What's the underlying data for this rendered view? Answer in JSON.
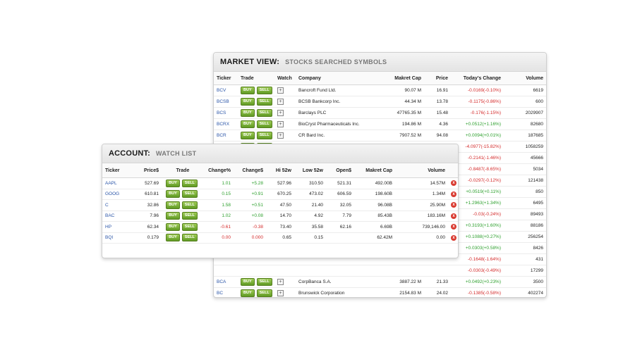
{
  "market": {
    "title": "MARKET VIEW:",
    "subtitle": "STOCKS SEARCHED SYMBOLS",
    "columns": [
      "Ticker",
      "Trade",
      "Watch",
      "Company",
      "Makret Cap",
      "Price",
      "Today's Change",
      "Volume"
    ],
    "rows": [
      {
        "ticker": "BCV",
        "company": "Bancroft Fund Ltd.",
        "cap": "90.07 M",
        "price": "16.91",
        "change": "-0.0169(-0.10%)",
        "dir": "neg",
        "volume": "6619"
      },
      {
        "ticker": "BCSB",
        "company": "BCSB Bankcorp Inc.",
        "cap": "44.34 M",
        "price": "13.78",
        "change": "-0.1175(-0.86%)",
        "dir": "neg",
        "volume": "600"
      },
      {
        "ticker": "BCS",
        "company": "Barclays PLC",
        "cap": "47765.35 M",
        "price": "15.48",
        "change": "-0.176(-1.15%)",
        "dir": "neg",
        "volume": "2029907"
      },
      {
        "ticker": "BCRX",
        "company": "BioCryst Pharmaceuticals Inc.",
        "cap": "194.86 M",
        "price": "4.36",
        "change": "+0.0512(+1.16%)",
        "dir": "pos",
        "volume": "82680"
      },
      {
        "ticker": "BCR",
        "company": "CR Bard Inc.",
        "cap": "7907.52 M",
        "price": "94.08",
        "change": "+0.0094(+0.01%)",
        "dir": "pos",
        "volume": "187685"
      },
      {
        "ticker": "BCPC",
        "company": "Balchem Corp.",
        "cap": "1032.49 M",
        "price": "30",
        "change": "-4.0977(-15.82%)",
        "dir": "neg",
        "volume": "1058259"
      },
      {
        "ticker": "",
        "company": "",
        "cap": "",
        "price": "",
        "change": "-0.2141(-1.46%)",
        "dir": "neg",
        "volume": "45666"
      },
      {
        "ticker": "",
        "company": "",
        "cap": "",
        "price": "",
        "change": "-0.8487(-8.65%)",
        "dir": "neg",
        "volume": "5034"
      },
      {
        "ticker": "",
        "company": "",
        "cap": "",
        "price": "",
        "change": "-0.0297(-0.12%)",
        "dir": "neg",
        "volume": "121438"
      },
      {
        "ticker": "",
        "company": "",
        "cap": "",
        "price": "",
        "change": "+0.0519(+0.11%)",
        "dir": "pos",
        "volume": "850"
      },
      {
        "ticker": "",
        "company": "",
        "cap": "",
        "price": "",
        "change": "+1.2963(+1.34%)",
        "dir": "pos",
        "volume": "6495"
      },
      {
        "ticker": "",
        "company": "",
        "cap": "",
        "price": "",
        "change": "-0.03(-0.24%)",
        "dir": "neg",
        "volume": "89493"
      },
      {
        "ticker": "",
        "company": "",
        "cap": "",
        "price": "",
        "change": "+0.3193(+1.60%)",
        "dir": "pos",
        "volume": "88186"
      },
      {
        "ticker": "",
        "company": "",
        "cap": "",
        "price": "",
        "change": "+0.1088(+0.27%)",
        "dir": "pos",
        "volume": "256254"
      },
      {
        "ticker": "",
        "company": "",
        "cap": "",
        "price": "",
        "change": "+0.0303(+0.58%)",
        "dir": "pos",
        "volume": "8426"
      },
      {
        "ticker": "",
        "company": "",
        "cap": "",
        "price": "",
        "change": "-0.1648(-1.64%)",
        "dir": "neg",
        "volume": "431"
      },
      {
        "ticker": "",
        "company": "",
        "cap": "",
        "price": "",
        "change": "-0.0303(-0.49%)",
        "dir": "neg",
        "volume": "17299"
      },
      {
        "ticker": "BCA",
        "company": "CorpBanca S.A.",
        "cap": "3887.22 M",
        "price": "21.33",
        "change": "+0.0492(+0.23%)",
        "dir": "pos",
        "volume": "3500"
      },
      {
        "ticker": "BC",
        "company": "Brunswick Corporation",
        "cap": "2154.83 M",
        "price": "24.02",
        "change": "-0.1385(-0.58%)",
        "dir": "neg",
        "volume": "402274"
      }
    ]
  },
  "account": {
    "title": "ACCOUNT:",
    "subtitle": "WATCH LIST",
    "columns": [
      "Ticker",
      "Price$",
      "Trade",
      "Change%",
      "Change$",
      "Hi 52w",
      "Low 52w",
      "Open$",
      "Makret Cap",
      "Volume"
    ],
    "rows": [
      {
        "ticker": "AAPL",
        "price": "527.69",
        "pct": "1.01",
        "chg": "+5.28",
        "dir": "pos",
        "hi": "527.96",
        "low": "310.50",
        "open": "521.31",
        "cap": "492.00B",
        "volume": "14.57M"
      },
      {
        "ticker": "GOOG",
        "price": "610.81",
        "pct": "0.15",
        "chg": "+0.91",
        "dir": "pos",
        "hi": "670.25",
        "low": "473.02",
        "open": "606.59",
        "cap": "198.60B",
        "volume": "1.34M"
      },
      {
        "ticker": "C",
        "price": "32.86",
        "pct": "1.58",
        "chg": "+0.51",
        "dir": "pos",
        "hi": "47.50",
        "low": "21.40",
        "open": "32.05",
        "cap": "96.08B",
        "volume": "25.90M"
      },
      {
        "ticker": "BAC",
        "price": "7.96",
        "pct": "1.02",
        "chg": "+0.08",
        "dir": "pos",
        "hi": "14.70",
        "low": "4.92",
        "open": "7.79",
        "cap": "85.43B",
        "volume": "183.16M"
      },
      {
        "ticker": "HP",
        "price": "62.34",
        "pct": "-0.61",
        "chg": "-0.38",
        "dir": "neg",
        "hi": "73.40",
        "low": "35.58",
        "open": "62.16",
        "cap": "6.69B",
        "volume": "739,146.00"
      },
      {
        "ticker": "BQI",
        "price": "0.179",
        "pct": "0.00",
        "chg": "0.000",
        "dir": "neg",
        "hi": "0.65",
        "low": "0.15",
        "open": "",
        "cap": "62.42M",
        "volume": "0.00"
      }
    ]
  },
  "buttons": {
    "buy": "BUY",
    "sell": "SELL",
    "watch": "+",
    "remove": "x"
  },
  "colors": {
    "positive": "#2ea02e",
    "negative": "#d42a2a",
    "ticker": "#2a55a8",
    "button": "#7fb33a"
  }
}
